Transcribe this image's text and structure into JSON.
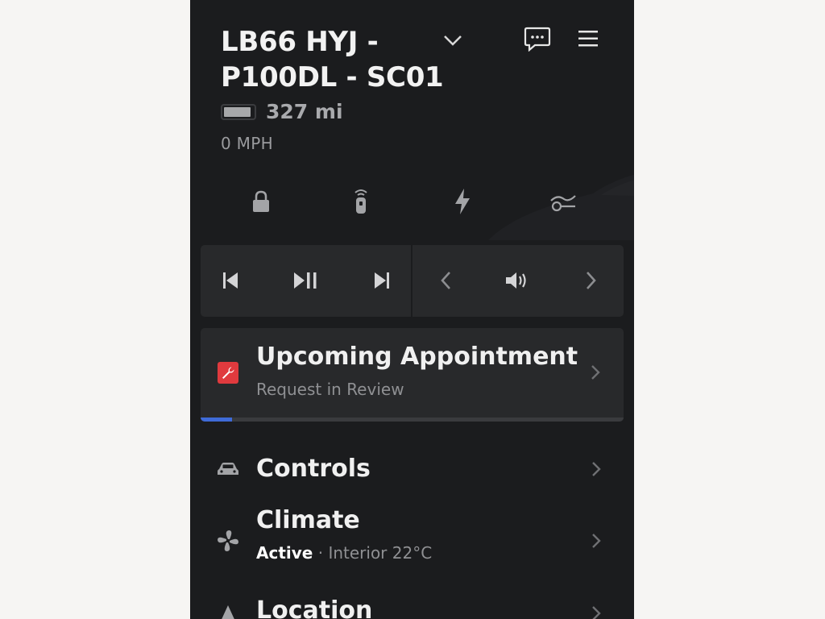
{
  "vehicle": {
    "name": "LB66 HYJ - P100DL - SC01",
    "range": "327 mi",
    "speed": "0 MPH",
    "battery_level": 0.92
  },
  "header": {
    "icons": [
      "chevron-down-icon",
      "chat-icon",
      "menu-icon"
    ]
  },
  "quick_actions": [
    {
      "icon": "lock-icon"
    },
    {
      "icon": "key-fob-icon"
    },
    {
      "icon": "bolt-icon"
    },
    {
      "icon": "fan-icon"
    }
  ],
  "media": {
    "controls": [
      "previous-track-icon",
      "play-pause-icon",
      "next-track-icon",
      "volume-down-icon",
      "volume-icon",
      "volume-up-icon"
    ]
  },
  "appointment": {
    "title": "Upcoming Appointment",
    "status": "Request in Review",
    "progress": 0.075,
    "icon": "wrench-icon",
    "accent": "#e03a3e",
    "progress_color": "#3f6bd8"
  },
  "menu": {
    "controls": {
      "label": "Controls",
      "icon": "car-icon"
    },
    "climate": {
      "label": "Climate",
      "status": "Active",
      "separator": " · ",
      "detail": "Interior 22°C",
      "icon": "fan-icon"
    },
    "location": {
      "label": "Location",
      "icon": "location-arrow-icon"
    }
  },
  "colors": {
    "background": "#1b1c1e",
    "card": "#28292b",
    "page": "#f6f5f3"
  }
}
